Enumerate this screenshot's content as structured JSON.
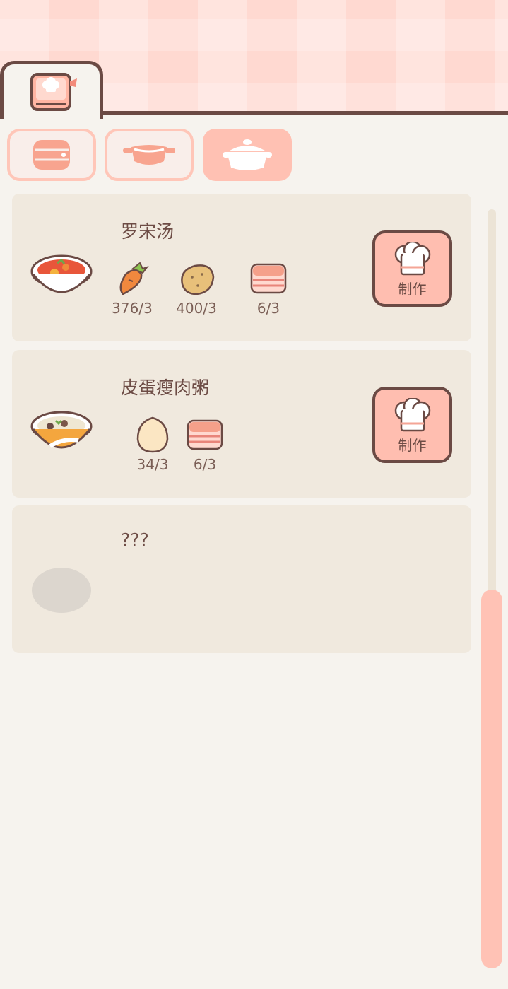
{
  "header": {
    "main_tab_icon": "recipe-book-icon"
  },
  "categories": [
    {
      "icon": "pot-stack-icon",
      "state": "outline"
    },
    {
      "icon": "pan-icon",
      "state": "outline"
    },
    {
      "icon": "casserole-icon",
      "state": "selected"
    }
  ],
  "colors": {
    "accent": "#ffc1b3",
    "outline": "#6b4a44",
    "card": "#f0e9de",
    "background": "#f6f3ee"
  },
  "recipes": [
    {
      "name": "罗宋汤",
      "dish_icon": "borscht-bowl-icon",
      "ingredients": [
        {
          "icon": "carrot-icon",
          "count": "376/3"
        },
        {
          "icon": "potato-icon",
          "count": "400/3"
        },
        {
          "icon": "bacon-icon",
          "count": "6/3"
        }
      ],
      "button_label": "制作"
    },
    {
      "name": "皮蛋瘦肉粥",
      "dish_icon": "congee-bowl-icon",
      "ingredients": [
        {
          "icon": "egg-icon",
          "count": "34/3"
        },
        {
          "icon": "bacon-icon",
          "count": "6/3"
        }
      ],
      "button_label": "制作"
    },
    {
      "name": "???",
      "dish_icon": "locked-dish-icon",
      "ingredients": []
    }
  ]
}
